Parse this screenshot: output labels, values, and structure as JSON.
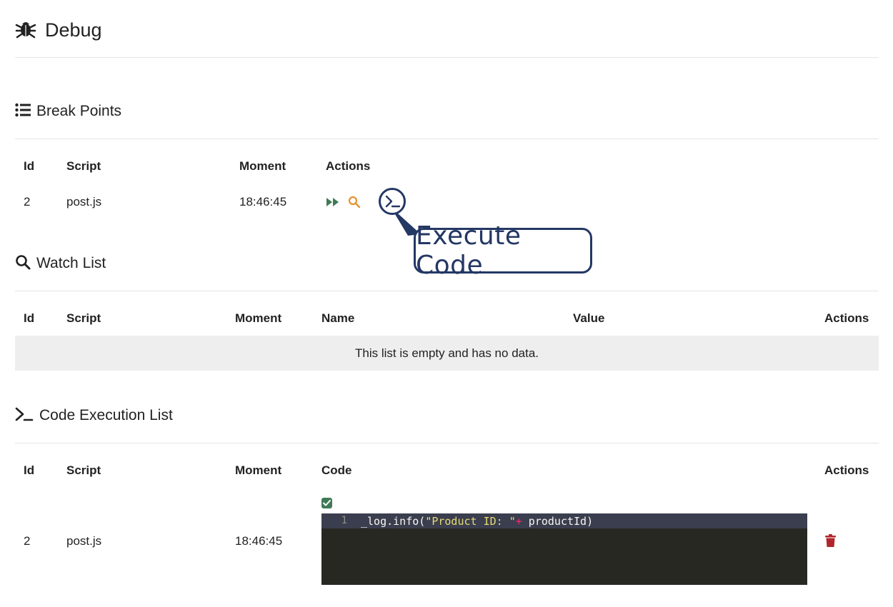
{
  "header": {
    "title": "Debug",
    "icon": "bug-icon"
  },
  "break_points": {
    "title": "Break Points",
    "icon": "list-icon",
    "columns": {
      "id": "Id",
      "script": "Script",
      "moment": "Moment",
      "actions": "Actions"
    },
    "rows": [
      {
        "id": "2",
        "script": "post.js",
        "moment": "18:46:45"
      }
    ],
    "callout": "Execute Code"
  },
  "watch_list": {
    "title": "Watch List",
    "icon": "search-icon",
    "columns": {
      "id": "Id",
      "script": "Script",
      "moment": "Moment",
      "name": "Name",
      "value": "Value",
      "actions": "Actions"
    },
    "empty_text": "This list is empty and has no data."
  },
  "code_execution": {
    "title": "Code Execution List",
    "icon": "terminal-icon",
    "columns": {
      "id": "Id",
      "script": "Script",
      "moment": "Moment",
      "code": "Code",
      "actions": "Actions"
    },
    "rows": [
      {
        "id": "2",
        "script": "post.js",
        "moment": "18:46:45",
        "line_number": "1",
        "code_prefix": "_log.info(",
        "code_string": "\"Product ID: \"",
        "code_op": "+",
        "code_suffix": " productId)"
      }
    ]
  },
  "colors": {
    "accent_green": "#3f7a56",
    "accent_orange": "#e8912d",
    "callout_navy": "#243864",
    "danger": "#b0262c"
  }
}
